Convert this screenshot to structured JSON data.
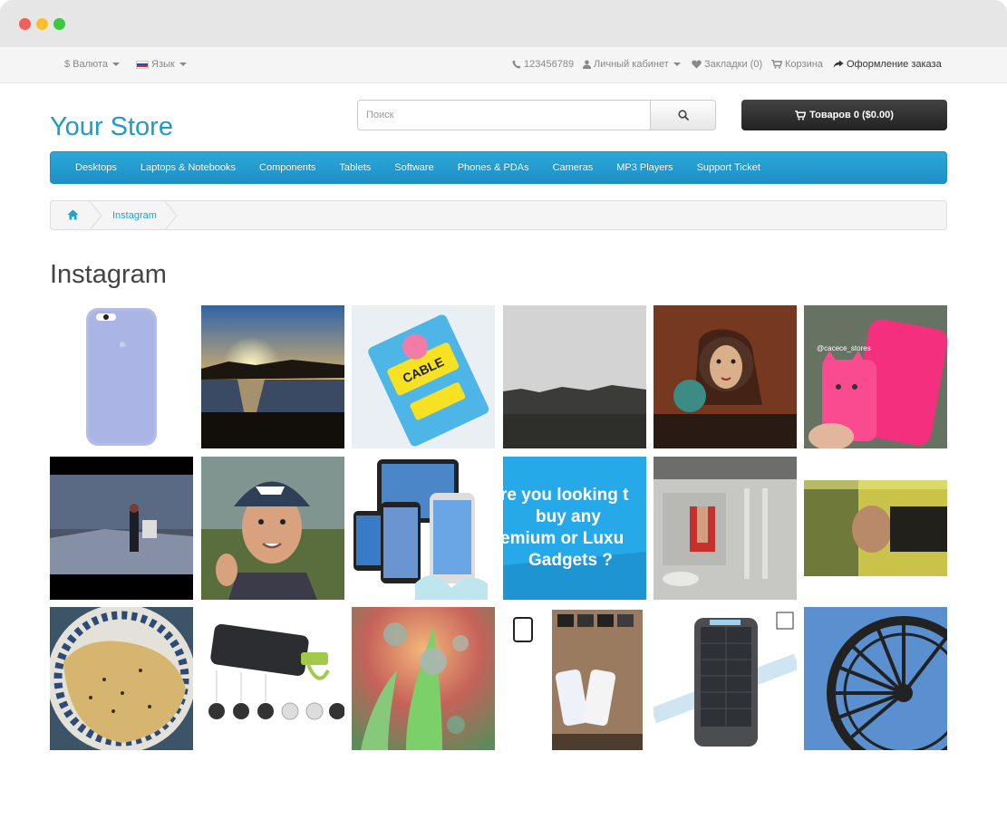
{
  "topbar": {
    "currency": "Валюта",
    "language": "Язык",
    "phone": "123456789",
    "account": "Личный кабинет",
    "wishlist": "Закладки (0)",
    "cart": "Корзина",
    "checkout": "Оформление заказа"
  },
  "header": {
    "logo": "Your Store",
    "search_placeholder": "Поиск",
    "cart_button": "Товаров 0 ($0.00)"
  },
  "menu": {
    "items": [
      "Desktops",
      "Laptops & Notebooks",
      "Components",
      "Tablets",
      "Software",
      "Phones & PDAs",
      "Cameras",
      "MP3 Players",
      "Support Ticket"
    ]
  },
  "breadcrumb": {
    "current": "Instagram"
  },
  "page": {
    "title": "Instagram"
  },
  "gallery": {
    "overlay_handle": "@cacece_stores",
    "ad_text": [
      "re you looking t",
      "buy any",
      "emium or Luxu",
      "Gadgets ?"
    ],
    "tiles": [
      "iphone-case-lavender",
      "sunset-lake",
      "cable-bites-package",
      "grey-sky-horizon",
      "street-mural",
      "pink-phone-case",
      "painter-night-scene",
      "selfie-cap",
      "iphones-splash",
      "luxury-gadgets-ad",
      "gym-mirror",
      "tilted-photo",
      "food-plate",
      "power-bank-ports",
      "water-droplets",
      "iphones-wall",
      "solar-charger",
      "ferris-wheel"
    ]
  },
  "colors": {
    "accent": "#229ac8",
    "menu": "#229ac8",
    "cart_button": "#303030"
  }
}
